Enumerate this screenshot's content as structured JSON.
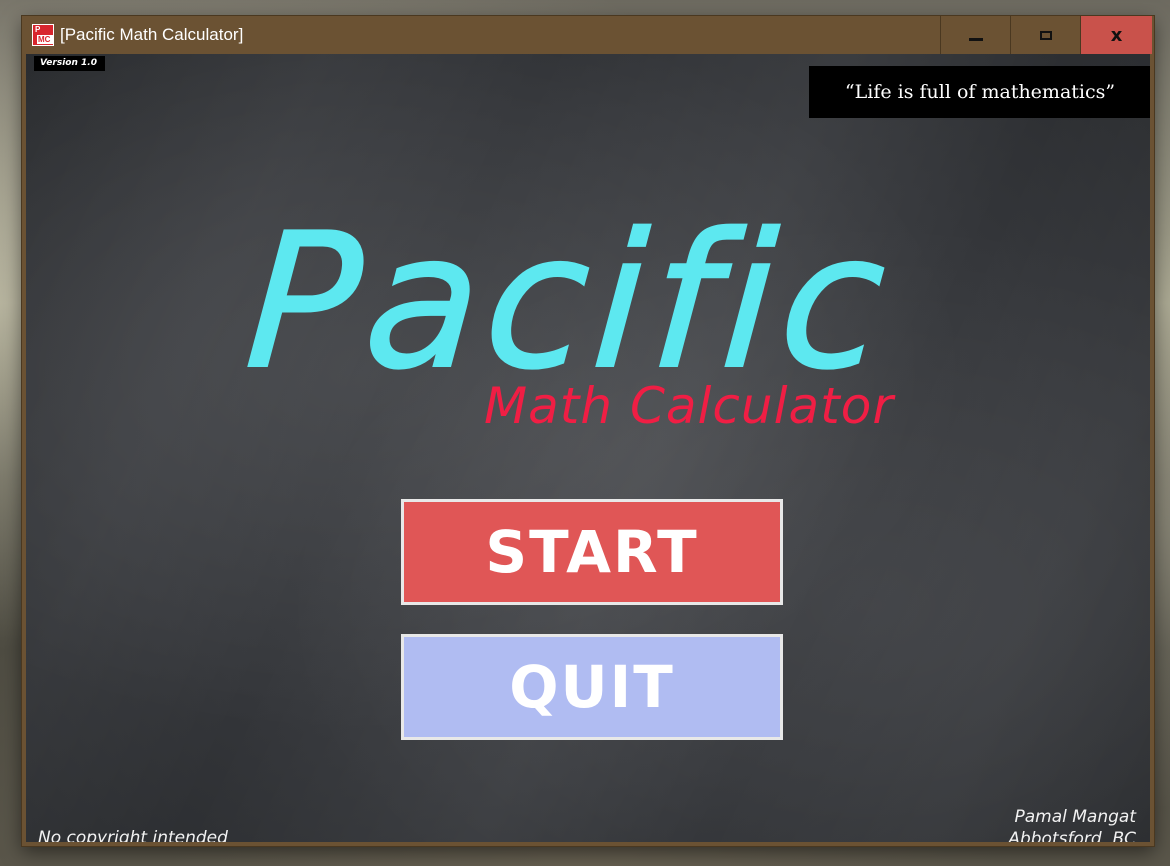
{
  "window": {
    "title": "[Pacific Math Calculator]",
    "icon_text_top": "P",
    "icon_text_bottom": "MC",
    "controls": [
      "minimize",
      "maximize",
      "close"
    ],
    "close_glyph": "x"
  },
  "app": {
    "version": "Version 1.0",
    "quote": "“Life is full of mathematics”",
    "logo_title": "Pacific",
    "logo_subtitle": "Math Calculator",
    "start_label": "START",
    "quit_label": "QUIT",
    "footer_left": "No copyright intended",
    "author_name": "Pamal Mangat",
    "author_location": "Abbotsford, BC"
  },
  "colors": {
    "title_cyan": "#5de8f0",
    "subtitle_red": "#f01e44",
    "start_button": "#e05656",
    "quit_button": "#b0bcf2",
    "close_button": "#c9524b",
    "titlebar": "#6b5233",
    "chalkboard": "#3a3c40"
  },
  "icons": {
    "app_icon": "pmc-app-icon",
    "minimize": "minimize-icon",
    "maximize": "maximize-icon",
    "close": "close-icon"
  }
}
